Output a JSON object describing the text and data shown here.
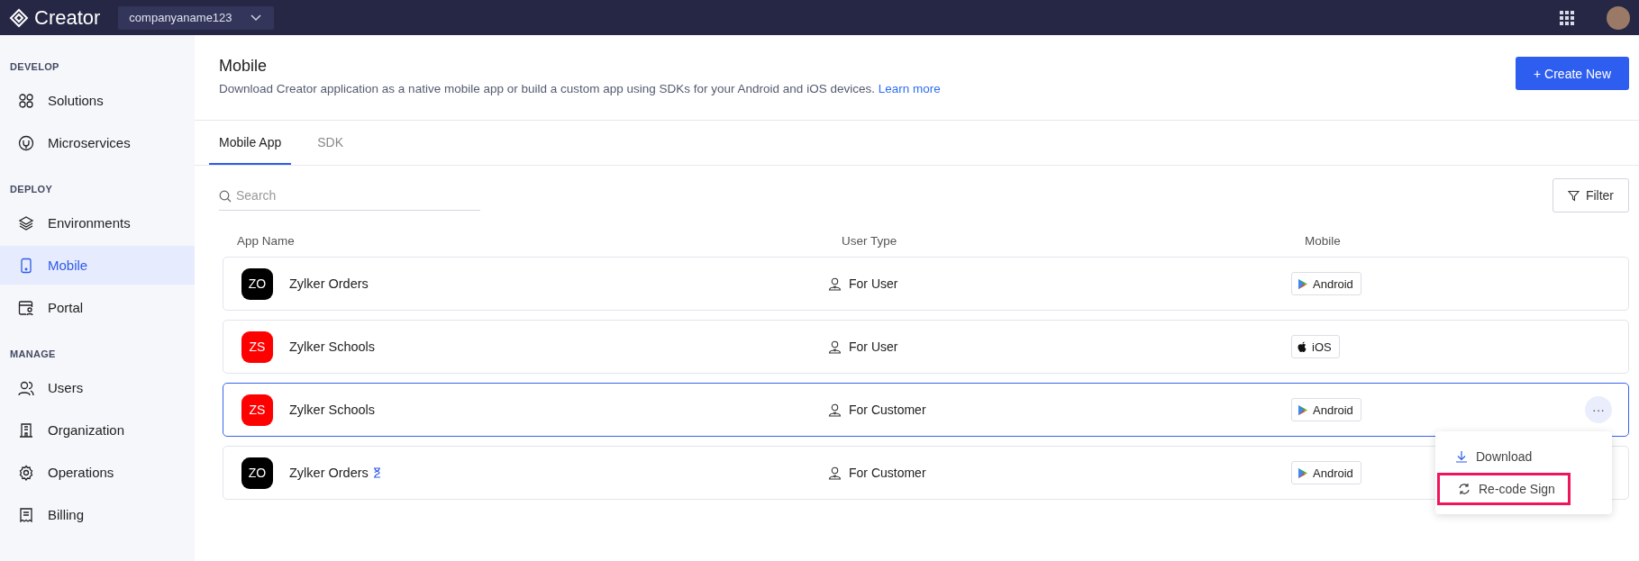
{
  "topbar": {
    "logo": "Creator",
    "org": "companyaname123"
  },
  "sidebar": {
    "sections": [
      {
        "heading": "DEVELOP",
        "items": [
          {
            "label": "Solutions",
            "kind": "solutions",
            "selected": false
          },
          {
            "label": "Microservices",
            "kind": "microservices",
            "selected": false
          }
        ]
      },
      {
        "heading": "DEPLOY",
        "items": [
          {
            "label": "Environments",
            "kind": "environments",
            "selected": false
          },
          {
            "label": "Mobile",
            "kind": "mobile",
            "selected": true
          },
          {
            "label": "Portal",
            "kind": "portal",
            "selected": false
          }
        ]
      },
      {
        "heading": "MANAGE",
        "items": [
          {
            "label": "Users",
            "kind": "users",
            "selected": false
          },
          {
            "label": "Organization",
            "kind": "organization",
            "selected": false
          },
          {
            "label": "Operations",
            "kind": "operations",
            "selected": false
          },
          {
            "label": "Billing",
            "kind": "billing",
            "selected": false
          }
        ]
      }
    ]
  },
  "header": {
    "title": "Mobile",
    "description": "Download Creator application as a native mobile app or build a custom app using SDKs for your Android and iOS devices.",
    "link": "Learn more",
    "create_button": "Create New",
    "create_icon": "+"
  },
  "tabs": [
    {
      "label": "Mobile App",
      "selected": true
    },
    {
      "label": "SDK",
      "selected": false
    }
  ],
  "search": {
    "placeholder": "Search"
  },
  "filter_button": "Filter",
  "table": {
    "columns": [
      "App Name",
      "User Type",
      "Mobile"
    ],
    "rows": [
      {
        "initials": "ZO",
        "color": "#000000",
        "name": "Zylker Orders",
        "pending": false,
        "user_type": "For User",
        "platform": "Android",
        "kind": "android",
        "selected": false
      },
      {
        "initials": "ZS",
        "color": "#ff0000",
        "name": "Zylker Schools",
        "pending": false,
        "user_type": "For User",
        "platform": "iOS",
        "kind": "ios",
        "selected": false
      },
      {
        "initials": "ZS",
        "color": "#ff0000",
        "name": "Zylker Schools",
        "pending": false,
        "user_type": "For Customer",
        "platform": "Android",
        "kind": "android",
        "selected": true
      },
      {
        "initials": "ZO",
        "color": "#000000",
        "name": "Zylker Orders",
        "pending": true,
        "user_type": "For Customer",
        "platform": "Android",
        "kind": "android",
        "selected": false
      }
    ]
  },
  "row_menu": {
    "more_label": "···",
    "items": [
      {
        "label": "Download",
        "kind": "download",
        "highlighted": false
      },
      {
        "label": "Re-code Sign",
        "kind": "recode",
        "highlighted": true
      }
    ]
  }
}
